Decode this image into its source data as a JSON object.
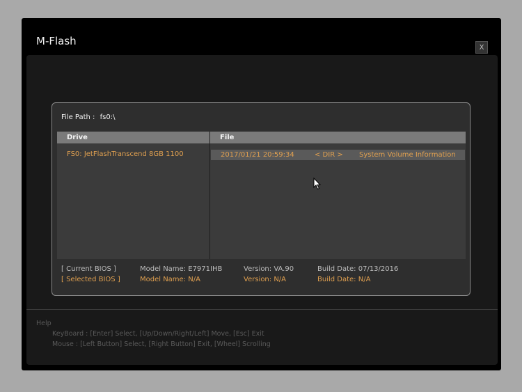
{
  "app": {
    "title": "M-Flash",
    "close_label": "X"
  },
  "file_path": {
    "label": "File Path :",
    "value": "fs0:\\"
  },
  "table": {
    "drive_header": "Drive",
    "file_header": "File",
    "drives": [
      "FS0: JetFlashTranscend 8GB 1100"
    ],
    "files": [
      {
        "date": "2017/01/21 20:59:34",
        "type": "< DIR >",
        "name": "System Volume Information"
      }
    ]
  },
  "bios": {
    "current": {
      "label": "[ Current BIOS   ]",
      "model": "Model Name: E7971IHB",
      "version": "Version: VA.90",
      "build": "Build Date: 07/13/2016"
    },
    "selected": {
      "label": "[ Selected BIOS ]",
      "model": "Model Name: N/A",
      "version": "Version: N/A",
      "build": "Build Date: N/A"
    }
  },
  "help": {
    "title": "Help",
    "keyboard": "KeyBoard :   [Enter]  Select,   [Up/Down/Right/Left]  Move,   [Esc]  Exit",
    "mouse": "Mouse     :   [Left Button]  Select,   [Right Button]  Exit,   [Wheel]  Scrolling"
  },
  "colors": {
    "accent": "#e0a050",
    "header": "#7a7a7a",
    "background": "#000000"
  },
  "icons": {
    "cursor": "mouse-pointer-icon"
  }
}
